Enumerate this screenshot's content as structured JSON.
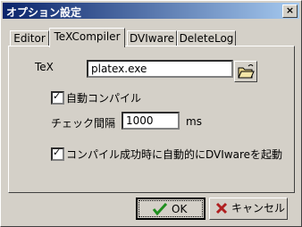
{
  "window": {
    "title": "オプション設定",
    "close_glyph": "×"
  },
  "tabs": [
    {
      "label": "Editor",
      "active": false
    },
    {
      "label": "TeXCompiler",
      "active": true
    },
    {
      "label": "DVIware",
      "active": false
    },
    {
      "label": "DeleteLog",
      "active": false
    }
  ],
  "tex": {
    "label": "TeX",
    "value": "platex.exe"
  },
  "auto_compile": {
    "label": "自動コンパイル",
    "checked": true
  },
  "check_interval": {
    "label": "チェック間隔",
    "value": "1000",
    "unit": "ms"
  },
  "launch_dvi": {
    "label": "コンパイル成功時に自動的にDVIwareを起動",
    "checked": true
  },
  "buttons": {
    "ok": "OK",
    "cancel": "キャンセル"
  },
  "icons": {
    "browse": "folder-open-icon",
    "ok": "checkmark-icon",
    "cancel": "x-icon"
  },
  "colors": {
    "titlebar_start": "#0a246a",
    "titlebar_end": "#a6caf0",
    "ok_check": "#1f8f1f",
    "cancel_x": "#b02020"
  }
}
